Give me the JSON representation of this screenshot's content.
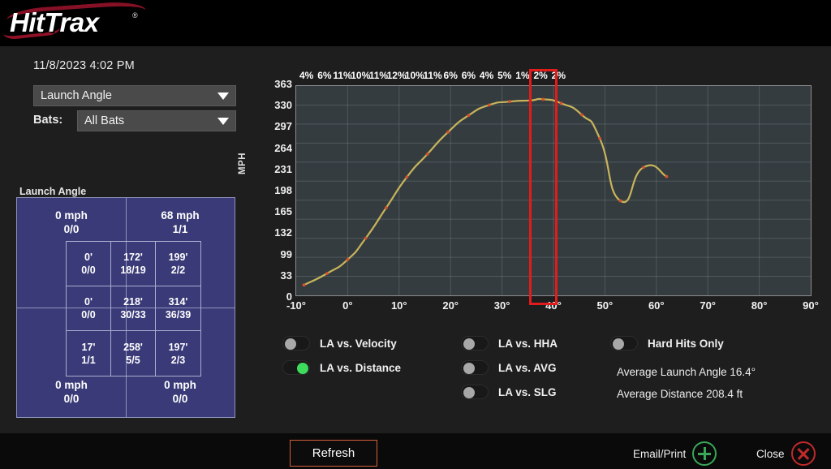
{
  "app": {
    "logo_text": "HitTrax",
    "trademark": "®"
  },
  "sidebar": {
    "timestamp": "11/8/2023 4:02 PM",
    "metric_dropdown": {
      "value": "Launch Angle"
    },
    "bats_label": "Bats:",
    "bats_dropdown": {
      "value": "All Bats"
    },
    "table_title": "Launch Angle",
    "corners": [
      {
        "pos": "tl",
        "primary": "0 mph",
        "secondary": "0/0"
      },
      {
        "pos": "tr",
        "primary": "68 mph",
        "secondary": "1/1"
      },
      {
        "pos": "bl",
        "primary": "0 mph",
        "secondary": "0/0"
      },
      {
        "pos": "br",
        "primary": "0 mph",
        "secondary": "0/0"
      }
    ],
    "grid_cells": [
      {
        "primary": "0'",
        "secondary": "0/0"
      },
      {
        "primary": "172'",
        "secondary": "18/19"
      },
      {
        "primary": "199'",
        "secondary": "2/2"
      },
      {
        "primary": "0'",
        "secondary": "0/0"
      },
      {
        "primary": "218'",
        "secondary": "30/33"
      },
      {
        "primary": "314'",
        "secondary": "36/39"
      },
      {
        "primary": "17'",
        "secondary": "1/1"
      },
      {
        "primary": "258'",
        "secondary": "5/5"
      },
      {
        "primary": "197'",
        "secondary": "2/3"
      }
    ]
  },
  "toggles": {
    "col1": [
      {
        "name": "la-vs-velocity",
        "label": "LA vs. Velocity",
        "on": false
      },
      {
        "name": "la-vs-distance",
        "label": "LA vs. Distance",
        "on": true
      }
    ],
    "col2": [
      {
        "name": "la-vs-hha",
        "label": "LA vs. HHA",
        "on": false
      },
      {
        "name": "la-vs-avg",
        "label": "LA vs. AVG",
        "on": false
      },
      {
        "name": "la-vs-slg",
        "label": "LA vs. SLG",
        "on": false
      }
    ],
    "col3": [
      {
        "name": "hard-hits-only",
        "label": "Hard Hits Only",
        "on": false
      }
    ]
  },
  "stats": [
    {
      "label": "Average Launch Angle",
      "value": "16.4°"
    },
    {
      "label": "Average Distance",
      "value": "208.4 ft"
    }
  ],
  "footer": {
    "refresh_label": "Refresh",
    "email_print_label": "Email/Print",
    "close_label": "Close"
  },
  "colors": {
    "accent_red": "#e21b1b",
    "line": "#c8b45a",
    "point": "#d4532a",
    "toggle_on": "#3ddc5c",
    "table_fill": "#3a3a78",
    "plot_bg": "#343c40",
    "refresh_border": "#d4603a",
    "plus_green": "#39a757",
    "close_red": "#c02a2a"
  },
  "chart_data": {
    "type": "line",
    "title": "",
    "xlabel": "",
    "ylabel": "MPH",
    "xlim": [
      -10,
      90
    ],
    "ylim": [
      0,
      363
    ],
    "grid": true,
    "legend_position": "below",
    "y_ticks": [
      0,
      33,
      99,
      132,
      165,
      198,
      231,
      264,
      297,
      330,
      363
    ],
    "y_tick_labels": [
      "0",
      "33",
      "99",
      "132",
      "165",
      "198",
      "231",
      "264",
      "297",
      "330",
      "363"
    ],
    "x_ticks": [
      -10,
      0,
      10,
      20,
      30,
      40,
      50,
      60,
      70,
      80,
      90
    ],
    "x_tick_labels": [
      "-10°",
      "0°",
      "10°",
      "20°",
      "30°",
      "40°",
      "50°",
      "60°",
      "70°",
      "80°",
      "90°"
    ],
    "percent_labels": [
      "4%",
      "6%",
      "11%",
      "10%",
      "11%",
      "12%",
      "10%",
      "11%",
      "6%",
      "6%",
      "4%",
      "5%",
      "1%",
      "2%",
      "2%"
    ],
    "percent_x": [
      -8,
      -4.5,
      -1,
      2.5,
      6,
      9.5,
      13,
      16.5,
      20,
      23.5,
      27,
      30.5,
      34,
      37.5,
      41
    ],
    "highlighted_percent_index": 9,
    "highlighted_percent_label": "6%",
    "series": [
      {
        "name": "LA vs. Distance",
        "x": [
          -8.5,
          -4.0,
          0.0,
          3.5,
          7.5,
          11.5,
          15.5,
          19.5,
          23.5,
          27.5,
          31.5,
          35.5,
          38.0,
          41.5,
          45.5,
          49.0,
          53.0,
          57.5,
          62.0
        ],
        "y": [
          18,
          38,
          62,
          99,
          152,
          205,
          245,
          283,
          312,
          330,
          336,
          338,
          340,
          333,
          313,
          272,
          164,
          222,
          206
        ]
      }
    ]
  }
}
